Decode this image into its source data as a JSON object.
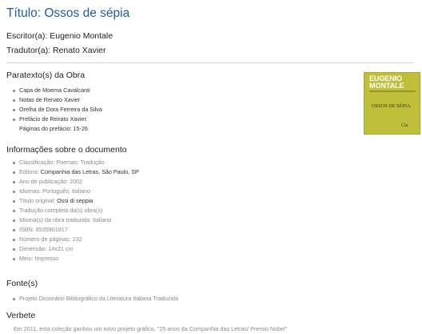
{
  "work": {
    "title": "Título: Ossos de sépia",
    "author": "Escritor(a): Eugenio Montale",
    "translator": "Tradutor(a): Renato Xavier"
  },
  "paratexts": {
    "heading": "Paratexto(s) da Obra",
    "items": [
      "Capa de Moema Cavalcanti",
      "Notas de Renato Xavier",
      "Orelha de Dora Ferreira da Silva",
      "Prefácio de Renato Xavier.",
      "Páginas do prefácio: 15-26"
    ]
  },
  "document_info": {
    "heading": "Informações sobre o documento",
    "items": [
      {
        "text": "Classificação: Poemas; Tradução"
      },
      {
        "label": "Editora: ",
        "value": "Companhia das Letras, São Paulo, SP"
      },
      {
        "text": "Ano de publicação: 2002"
      },
      {
        "text": "Idiomas: Português; Italiano"
      },
      {
        "label": "Título original: ",
        "value": "Ossi di seppia"
      },
      {
        "text": "Tradução completa da(s) obra(s)"
      },
      {
        "text": "Idioma(s) da obra traduzida: Italiano"
      },
      {
        "text": "ISBN: 8535901817"
      },
      {
        "text": "Número de páginas: 232"
      },
      {
        "text": "Dimensão: 14x21 cm"
      },
      {
        "text": "Meio: Impresso"
      }
    ]
  },
  "sources": {
    "heading": "Fonte(s)",
    "items": [
      "Projeto Dicionário Bibliográfico da Literatura Italiana Traduzida"
    ]
  },
  "entry": {
    "heading": "Verbete",
    "text": "Em 2011, esta coleção ganhou um novo projeto gráfico, \"25 anos da Companhia das Letras/ Premio Nobel\""
  },
  "cover": {
    "author_line1": "EUGENIO",
    "author_line2": "MONTALE",
    "title": "OSSOS DE SÉPIA",
    "publisher_mark": "Cia"
  }
}
